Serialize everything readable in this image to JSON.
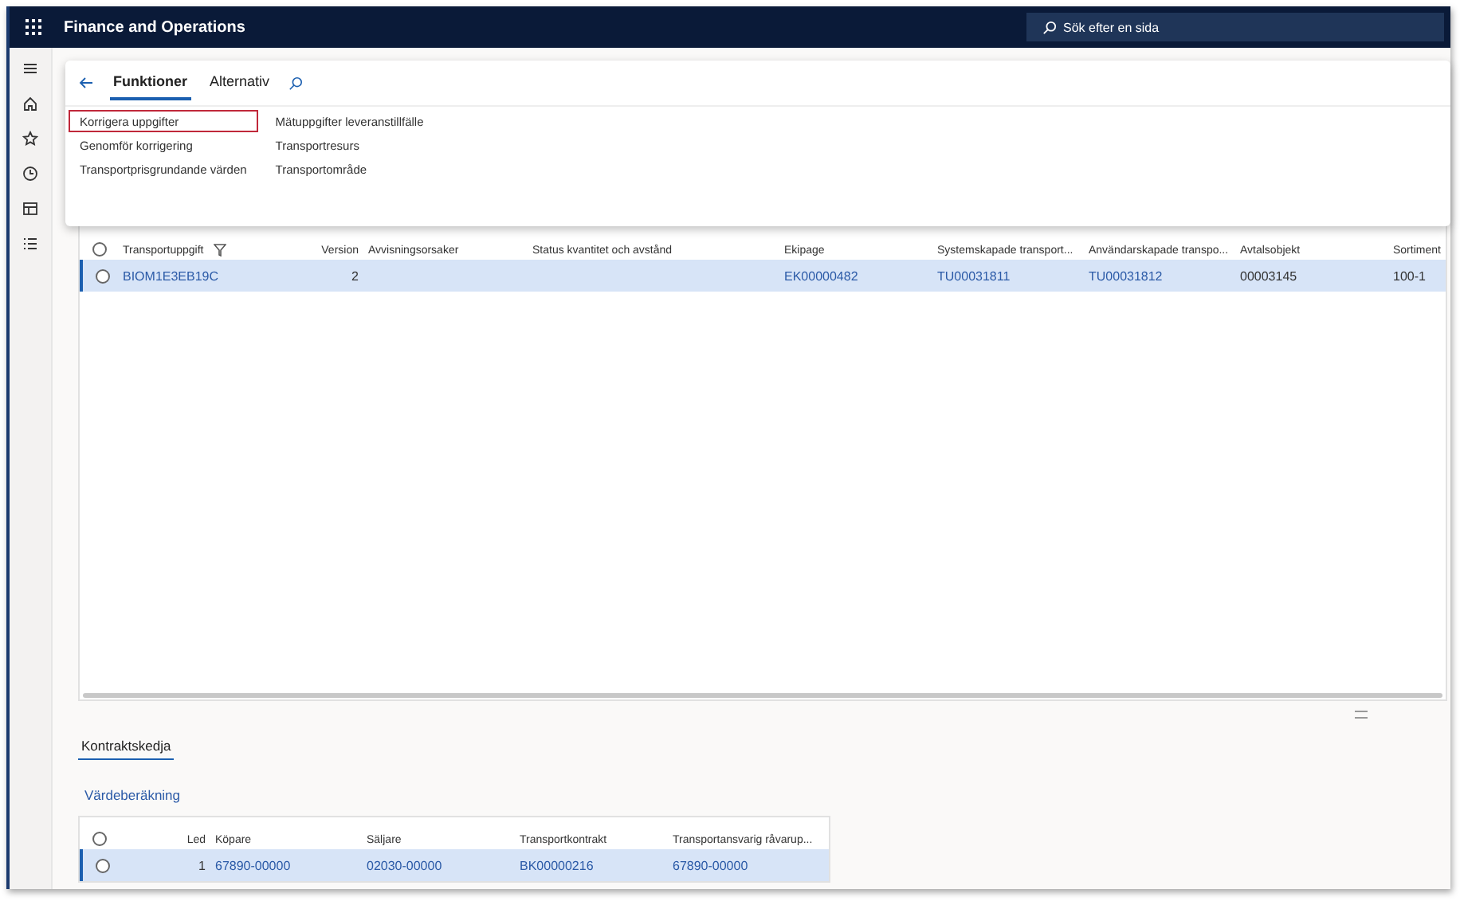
{
  "app": {
    "title": "Finance and Operations",
    "search": {
      "placeholder": "Sök efter en sida"
    }
  },
  "action_pane": {
    "tabs": [
      {
        "label": "Funktioner",
        "selected": true
      },
      {
        "label": "Alternativ",
        "selected": false
      }
    ],
    "groups": [
      {
        "items": [
          {
            "label": "Korrigera uppgifter",
            "highlighted": true
          },
          {
            "label": "Genomför korrigering",
            "highlighted": false
          },
          {
            "label": "Transportprisgrundande värden",
            "highlighted": false
          }
        ]
      },
      {
        "items": [
          {
            "label": "Mätuppgifter leveranstillfälle",
            "highlighted": false
          },
          {
            "label": "Transportresurs",
            "highlighted": false
          },
          {
            "label": "Transportområde",
            "highlighted": false
          }
        ]
      }
    ]
  },
  "grid": {
    "all_checked": false,
    "columns": [
      {
        "label": "Transportuppgift",
        "kind": "link"
      },
      {
        "label": "Version",
        "kind": "number"
      },
      {
        "label": "Avvisningsorsaker",
        "kind": "text"
      },
      {
        "label": "Status kvantitet och avstånd",
        "kind": "text"
      },
      {
        "label": "Ekipage",
        "kind": "link"
      },
      {
        "label": "Systemskapade transport...",
        "kind": "link"
      },
      {
        "label": "Användarskapade transpo...",
        "kind": "link"
      },
      {
        "label": "Avtalsobjekt",
        "kind": "text"
      },
      {
        "label": "Sortiment",
        "kind": "text"
      }
    ],
    "rows": [
      {
        "selected": true,
        "checked": false,
        "cells": [
          "BIOM1E3EB19C",
          "2",
          "",
          "",
          "EK00000482",
          "TU00031811",
          "TU00031812",
          "00003145",
          "100-1"
        ]
      }
    ]
  },
  "tabs": [
    {
      "label": "Kontraktskedja",
      "selected": true
    }
  ],
  "section_link": "Värdeberäkning",
  "grid2": {
    "all_checked": false,
    "columns": [
      {
        "label": "Led",
        "kind": "number"
      },
      {
        "label": "Köpare",
        "kind": "link"
      },
      {
        "label": "Säljare",
        "kind": "link"
      },
      {
        "label": "Transportkontrakt",
        "kind": "link"
      },
      {
        "label": "Transportansvarig råvarup...",
        "kind": "link"
      }
    ],
    "rows": [
      {
        "selected": true,
        "checked": false,
        "cells": [
          "1",
          "67890-00000",
          "02030-00000",
          "BK00000216",
          "67890-00000"
        ]
      }
    ]
  }
}
